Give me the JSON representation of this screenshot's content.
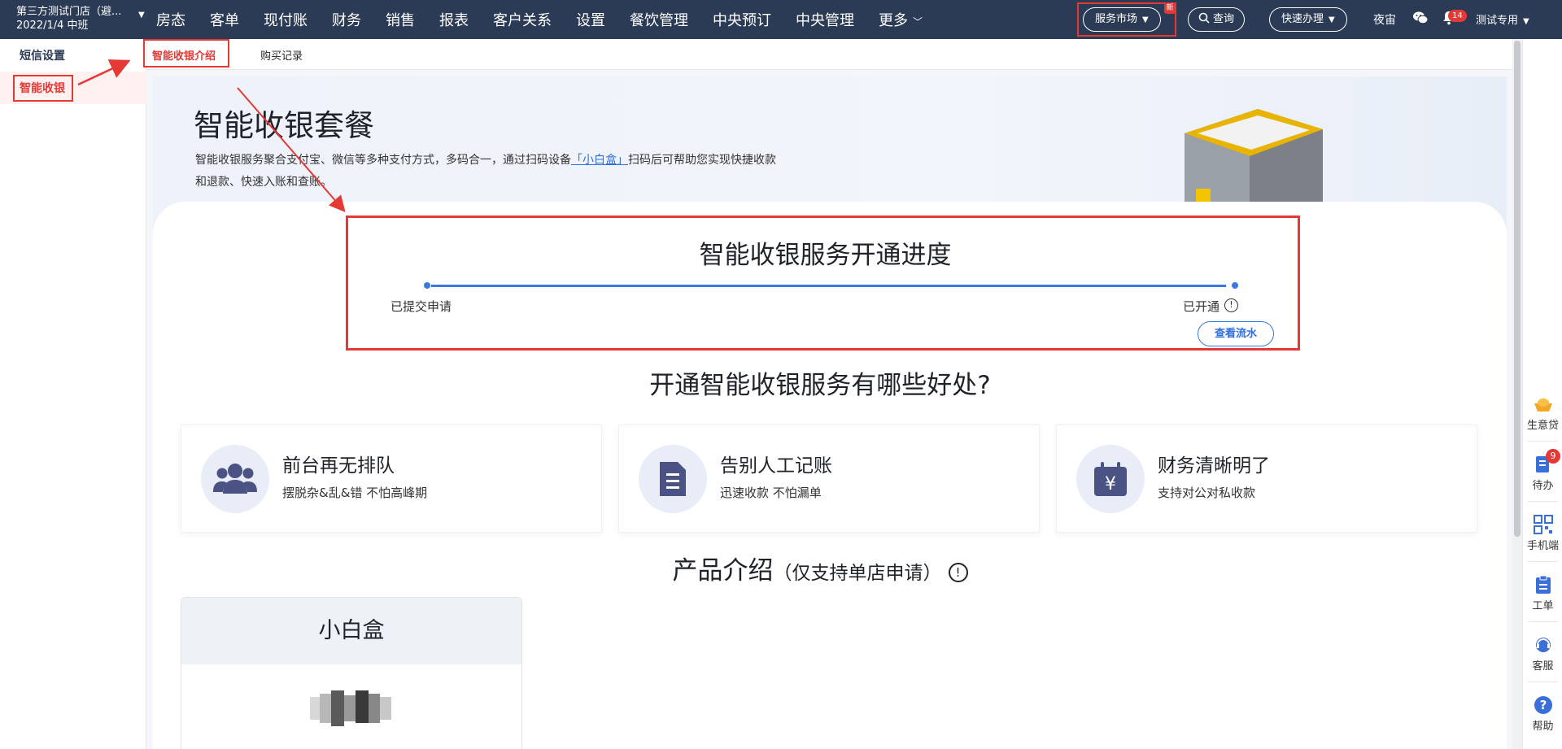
{
  "topbar": {
    "store_name": "第三方测试门店（避...",
    "store_date": "2022/1/4 中班",
    "nav": [
      "房态",
      "客单",
      "现付账",
      "财务",
      "销售",
      "报表",
      "客户关系",
      "设置",
      "餐饮管理",
      "中央预订",
      "中央管理",
      "更多"
    ],
    "service_market": "服务市场",
    "new_badge": "新",
    "search": "查询",
    "quick": "快速办理",
    "night_mode": "夜宙",
    "bell_count": "14",
    "user": "测试专用"
  },
  "sidebar": {
    "items": [
      "短信设置",
      "智能收银"
    ]
  },
  "tabs": [
    "智能收银介绍",
    "购买记录"
  ],
  "banner": {
    "title": "智能收银套餐",
    "desc_before": "智能收银服务聚合支付宝、微信等多种支付方式，多码合一，通过扫码设备",
    "desc_link": "「小白盒」",
    "desc_after": "扫码后可帮助您实现快捷收款和退款、快速入账和查账。"
  },
  "progress": {
    "title": "智能收银服务开通进度",
    "step_start": "已提交申请",
    "step_end": "已开通",
    "info": "!",
    "flow_button": "查看流水"
  },
  "benefits": {
    "title": "开通智能收银服务有哪些好处?",
    "cards": [
      {
        "title": "前台再无排队",
        "sub": "摆脱杂&乱&错 不怕高峰期"
      },
      {
        "title": "告别人工记账",
        "sub": "迅速收款 不怕漏单"
      },
      {
        "title": "财务清晰明了",
        "sub": "支持对公对私收款"
      }
    ]
  },
  "product": {
    "title": "产品介绍",
    "note": "（仅支持单店申请）",
    "info": "!",
    "card_title": "小白盒"
  },
  "rail": {
    "items": [
      "生意贷",
      "待办",
      "手机端",
      "工单",
      "客服",
      "帮助"
    ],
    "todo_badge": "9"
  },
  "colors": {
    "topbar": "#2b3a55",
    "accent_red": "#e53935",
    "link_blue": "#2f6fe0",
    "icon_purple": "#4b5384"
  }
}
